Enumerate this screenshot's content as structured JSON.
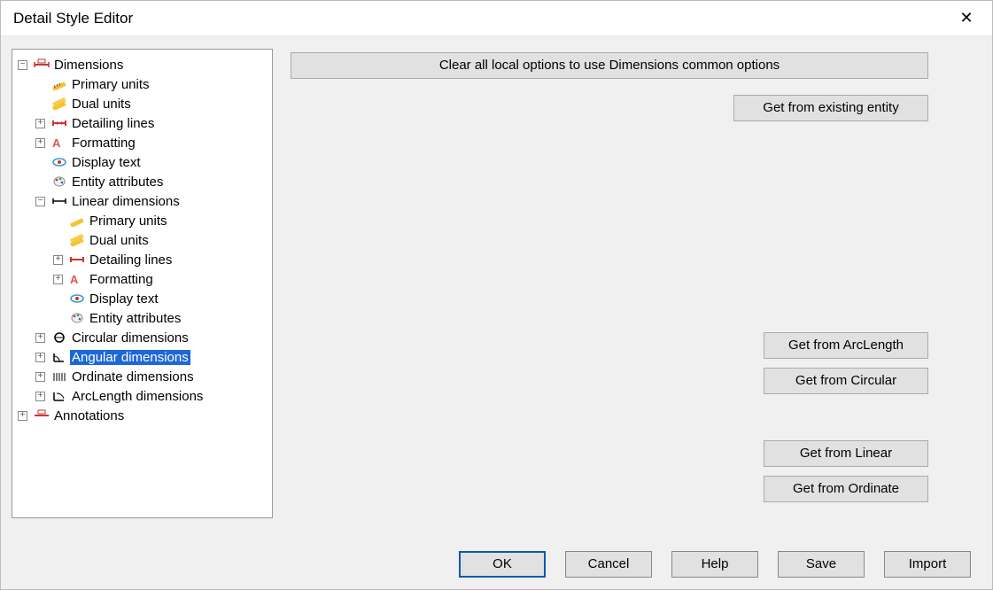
{
  "window": {
    "title": "Detail Style Editor"
  },
  "tree": {
    "dimensions": {
      "label": "Dimensions",
      "primary_units": "Primary units",
      "dual_units": "Dual units",
      "detailing_lines": "Detailing lines",
      "formatting": "Formatting",
      "display_text": "Display text",
      "entity_attributes": "Entity attributes",
      "linear": {
        "label": "Linear dimensions",
        "primary_units": "Primary units",
        "dual_units": "Dual units",
        "detailing_lines": "Detailing lines",
        "formatting": "Formatting",
        "display_text": "Display text",
        "entity_attributes": "Entity attributes"
      },
      "circular": "Circular dimensions",
      "angular": "Angular dimensions",
      "ordinate": "Ordinate dimensions",
      "arclength": "ArcLength dimensions"
    },
    "annotations": "Annotations"
  },
  "buttons": {
    "clear_local": "Clear all local options to use Dimensions common options",
    "get_existing": "Get from existing entity",
    "get_arclength": "Get from ArcLength",
    "get_circular": "Get from Circular",
    "get_linear": "Get from Linear",
    "get_ordinate": "Get from Ordinate"
  },
  "footer": {
    "ok": "OK",
    "cancel": "Cancel",
    "help": "Help",
    "save": "Save",
    "import": "Import"
  }
}
